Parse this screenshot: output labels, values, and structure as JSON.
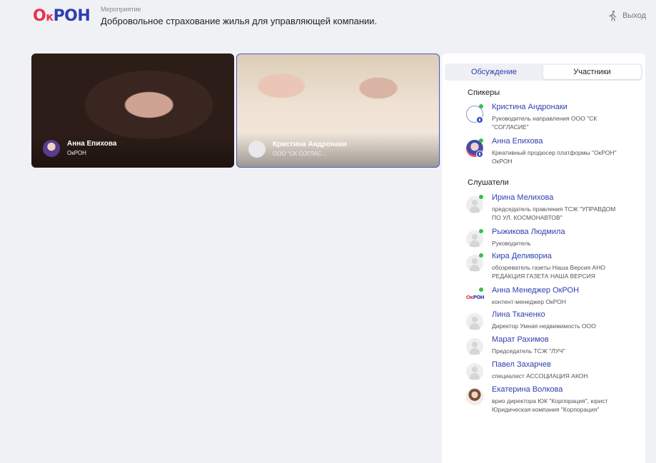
{
  "header": {
    "logo": {
      "part1": "О",
      "part2": "к",
      "part3": "РОН"
    },
    "event_label": "Мероприятие",
    "event_title": "Добровольное страхование жилья для управляющей компании.",
    "exit_label": "Выход"
  },
  "videos": [
    {
      "name": "Анна Епихова",
      "org": "ОкРОН"
    },
    {
      "name": "Кристина Андронаки",
      "org": "ООО \"СК СОГЛАС..."
    }
  ],
  "panel": {
    "tabs": [
      {
        "label": "Обсуждение",
        "active": false
      },
      {
        "label": "Участники",
        "active": true
      }
    ],
    "speakers_title": "Спикеры",
    "speakers": [
      {
        "name": "Кристина Андронаки",
        "role": "Руководитель направления ООО \"СК \"СОГЛАСИЕ\"",
        "online": true
      },
      {
        "name": "Анна Епихова",
        "role": "Креативный продюсер платформы \"ОкРОН\" ОкРОН",
        "online": true
      }
    ],
    "listeners_title": "Слушатели",
    "listeners": [
      {
        "name": "Ирина Мелихова",
        "role": "председатель правления ТСЖ \"УПРАВДОМ ПО УЛ. КОСМОНАВТОВ\"",
        "online": true
      },
      {
        "name": "Рыжикова Людмила",
        "role": "Руководитель",
        "online": true
      },
      {
        "name": "Кира Деливориа",
        "role": "обозреватель газеты Наша Версия АНО РЕДАКЦИЯ ГАЗЕТА НАША ВЕРСИЯ",
        "online": true
      },
      {
        "name": "Анна Менеджер ОкРОН",
        "role": "контент-менеджер ОкРОН",
        "online": true,
        "avatar_text": {
          "a": "Ок",
          "b": "РОН"
        }
      },
      {
        "name": "Лина Ткаченко",
        "role": "Директор Умная недвижимость ООО",
        "online": false
      },
      {
        "name": "Марат Рахимов",
        "role": "Председатель ТСЖ \"ЛУЧ\"",
        "online": false
      },
      {
        "name": "Павел Захарчев",
        "role": "специалист АССОЦИАЦИЯ АКОН",
        "online": false
      },
      {
        "name": "Екатерина Волкова",
        "role": "врио директора ЮК \"Корпорация\", юрист Юридическая компания \"Корпорация\"",
        "online": false
      }
    ]
  },
  "colors": {
    "accent": "#2f3fb0",
    "brand_red": "#e8324c",
    "online": "#35c04a",
    "background": "#f0f1f5"
  },
  "icons": {
    "exit": "walking-person-icon",
    "mic": "mic-icon",
    "placeholder": "user-placeholder-icon"
  }
}
